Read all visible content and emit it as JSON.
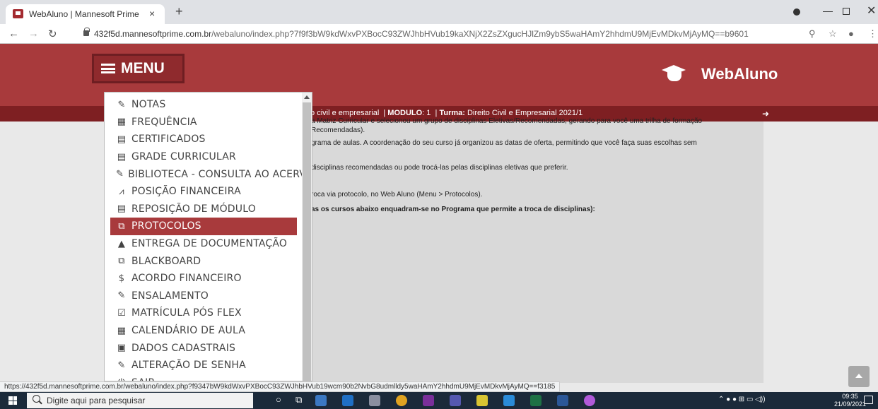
{
  "browser": {
    "tab_title": "WebAluno | Mannesoft Prime",
    "tab_close": "×",
    "new_tab": "+",
    "url_host": "432f5d.mannesoftprime.com.br",
    "url_path": "/webaluno/index.php?7f9f3bW9kdWxvPXBocC93ZWJhbHVub19kaXNjX2ZsZXgucHJlZm9ybS5waHAmY2hhdmU9MjEvMDkvMjAyMQ==b9601"
  },
  "header": {
    "menu_label": "MENU",
    "brand": "WebAluno"
  },
  "infobar": {
    "course_tail": "to civil e empresarial",
    "modulo_label": "MODULO",
    "modulo_value": ": 1",
    "turma_label": "Turma:",
    "turma_value": "Direito Civil e Empresarial 2021/1"
  },
  "content": {
    "line1": "a Matriz Curricular e selecionou um grupo de disciplinas Eletivas/Recomendadas, gerando para você uma trilha de formação",
    "line2": "Recomendadas).",
    "line3": "grama de aulas. A coordenação do seu curso já organizou as datas de oferta, permitindo que você faça suas escolhas sem",
    "line4": "disciplinas recomendadas ou pode trocá-las pelas disciplinas eletivas que preferir.",
    "line5": "roca via protocolo, no Web Aluno (Menu > Protocolos).",
    "line6": "as os cursos abaixo enquadram-se no Programa que permite a troca de disciplinas):"
  },
  "menu": {
    "items": [
      {
        "label": "NOTAS",
        "icon": "✎",
        "icon_name": "edit-icon"
      },
      {
        "label": "FREQUÊNCIA",
        "icon": "▦",
        "icon_name": "calendar-icon"
      },
      {
        "label": "CERTIFICADOS",
        "icon": "▤",
        "icon_name": "calendar-grid-icon"
      },
      {
        "label": "GRADE CURRICULAR",
        "icon": "▤",
        "icon_name": "calendar-grid-icon"
      },
      {
        "label": "BIBLIOTECA - CONSULTA AO ACERVO",
        "icon": "✎",
        "icon_name": "edit-icon"
      },
      {
        "label": "POSIÇÃO FINANCEIRA",
        "icon": "⩘",
        "icon_name": "line-chart-icon"
      },
      {
        "label": "REPOSIÇÃO DE MÓDULO",
        "icon": "▤",
        "icon_name": "calendar-grid-icon"
      },
      {
        "label": "PROTOCOLOS",
        "icon": "⧉",
        "icon_name": "copy-icon"
      },
      {
        "label": "ENTREGA DE DOCUMENTAÇÃO",
        "icon": "▲",
        "icon_name": "warning-icon"
      },
      {
        "label": "BLACKBOARD",
        "icon": "⧉",
        "icon_name": "external-link-icon"
      },
      {
        "label": "ACORDO FINANCEIRO",
        "icon": "$",
        "icon_name": "dollar-circle-icon"
      },
      {
        "label": "ENSALAMENTO",
        "icon": "✎",
        "icon_name": "edit-icon"
      },
      {
        "label": "MATRÍCULA PÓS FLEX",
        "icon": "☑",
        "icon_name": "checklist-icon"
      },
      {
        "label": "CALENDÁRIO DE AULA",
        "icon": "▦",
        "icon_name": "calendar-icon"
      },
      {
        "label": "DADOS CADASTRAIS",
        "icon": "▣",
        "icon_name": "id-card-icon"
      },
      {
        "label": "ALTERAÇÃO DE SENHA",
        "icon": "✎",
        "icon_name": "edit-icon"
      },
      {
        "label": "SAIR",
        "icon": "⏻",
        "icon_name": "power-icon"
      }
    ],
    "active_index": 7
  },
  "status": {
    "link_url": "https://432f5d.mannesoftprime.com.br/webaluno/index.php?f9347bW9kdWxvPXBocC93ZWJhbHVub19wcm90b2NvbG8udmlldy5waHAmY2hhdmU9MjEvMDkvMjAyMQ==f3185"
  },
  "taskbar": {
    "search_placeholder": "Digite aqui para pesquisar",
    "time": "09:35",
    "date": "21/09/2021"
  },
  "colors": {
    "brand_red": "#a83a3c",
    "dark_red": "#7e1f22",
    "active_item": "#a83a3c"
  }
}
